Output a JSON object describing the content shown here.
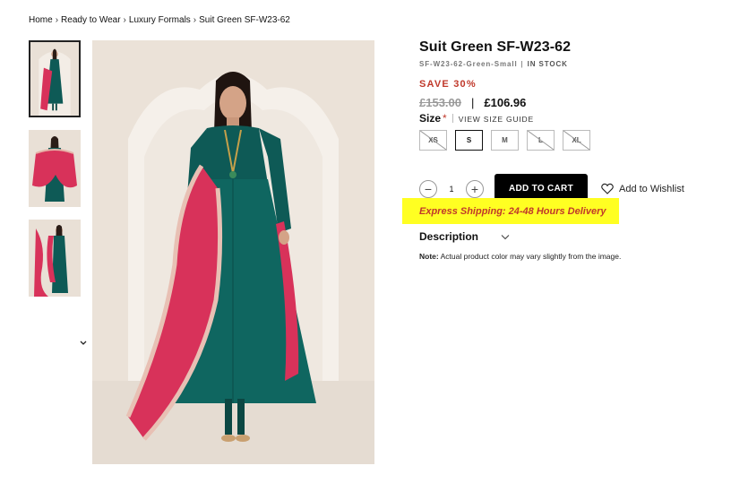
{
  "breadcrumb": {
    "home": "Home",
    "category": "Ready to Wear",
    "subcategory": "Luxury Formals",
    "current": "Suit Green SF-W23-62",
    "separator": "›"
  },
  "product": {
    "title": "Suit Green SF-W23-62",
    "sku": "SF-W23-62-Green-Small",
    "sku_divider": "|",
    "stock": "IN STOCK",
    "save_label": "SAVE 30%",
    "old_price": "£153.00",
    "price_divider": "|",
    "new_price": "£106.96",
    "size_label": "Size",
    "required_mark": "*",
    "size_guide": "VIEW SIZE GUIDE",
    "sizes": [
      {
        "label": "XS",
        "available": false
      },
      {
        "label": "S",
        "available": true,
        "selected": true
      },
      {
        "label": "M",
        "available": true
      },
      {
        "label": "L",
        "available": false
      },
      {
        "label": "XL",
        "available": false
      }
    ],
    "quantity": "1",
    "qty_minus": "−",
    "qty_plus": "+",
    "add_to_cart": "ADD TO CART",
    "wishlist": "Add to Wishlist",
    "shipping": "Express Shipping: 24-48 Hours Delivery",
    "description_label": "Description",
    "note_label": "Note:",
    "note_text": " Actual product color may vary slightly from the image."
  },
  "colors": {
    "accent_red": "#c0392b",
    "highlight": "#ffff22",
    "button_black": "#000000",
    "dress_teal": "#0e5a56",
    "dupatta_pink": "#d8325a"
  },
  "icons": {
    "wishlist": "heart-icon",
    "description": "chevron-down-icon",
    "thumbs_nav": "chevron-down-icon"
  }
}
